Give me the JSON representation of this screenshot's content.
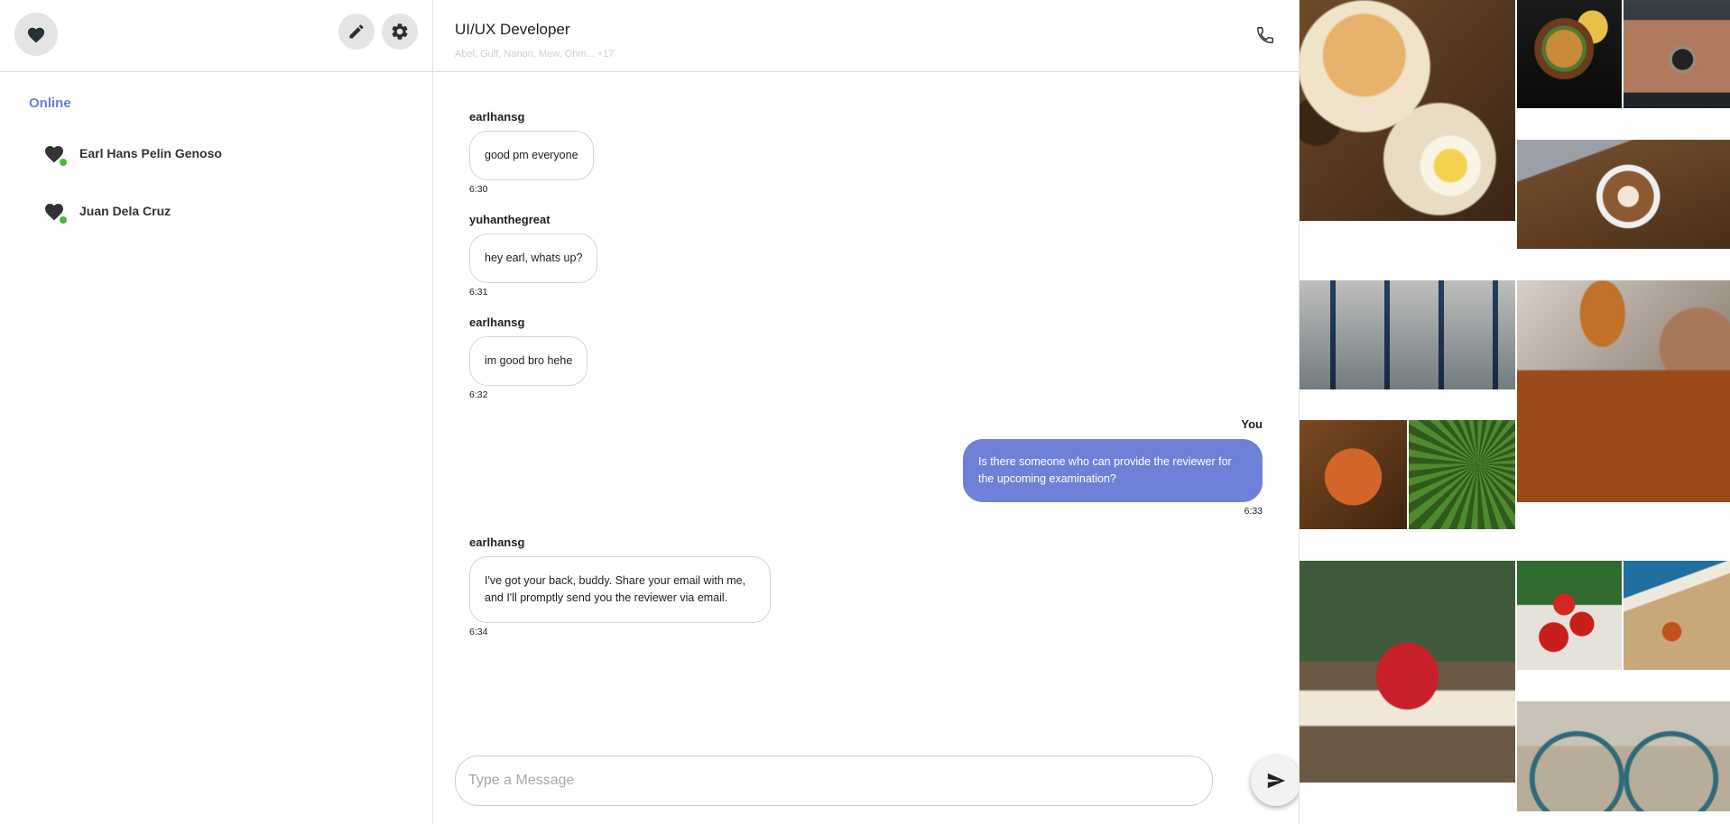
{
  "sidebar": {
    "section_title": "Online",
    "users": [
      {
        "name": "Earl Hans Pelin Genoso",
        "status": "online"
      },
      {
        "name": "Juan Dela Cruz",
        "status": "online"
      }
    ]
  },
  "chat": {
    "title": "UI/UX Developer",
    "members": "Abel, Gulf, Nanon, Mew, Ohm... +17",
    "messages": [
      {
        "sender": "earlhansg",
        "text": "good pm everyone",
        "time": "6:30"
      },
      {
        "sender": "yuhanthegreat",
        "text": "hey earl, whats up?",
        "time": "6:31"
      },
      {
        "sender": "earlhansg",
        "text": "im good bro hehe",
        "time": "6:32"
      },
      {
        "sender": "You",
        "text": "Is there someone who can provide the reviewer for the upcoming examination?",
        "time": "6:33",
        "mine": true
      },
      {
        "sender": "earlhansg",
        "text": "I've got your back, buddy. Share your email with me, and I'll promptly send you the reviewer via email.",
        "time": "6:34"
      }
    ],
    "composer": {
      "placeholder": "Type a Message"
    }
  },
  "gallery": {
    "images": [
      "breakfast",
      "burger",
      "camera",
      "coffee",
      "hats",
      "honey",
      "basketball",
      "fern",
      "mushroom",
      "tomatoes",
      "starfish",
      "bicycle"
    ]
  },
  "colors": {
    "accent": "#6b7fd7",
    "my_bubble": "#6f80d9",
    "online_dot": "#3fbf2f",
    "icon_dark": "#263238"
  },
  "icons": {
    "profile": "heart-icon",
    "edit": "pencil-icon",
    "settings": "gear-icon",
    "call": "phone-icon",
    "send": "send-icon"
  }
}
